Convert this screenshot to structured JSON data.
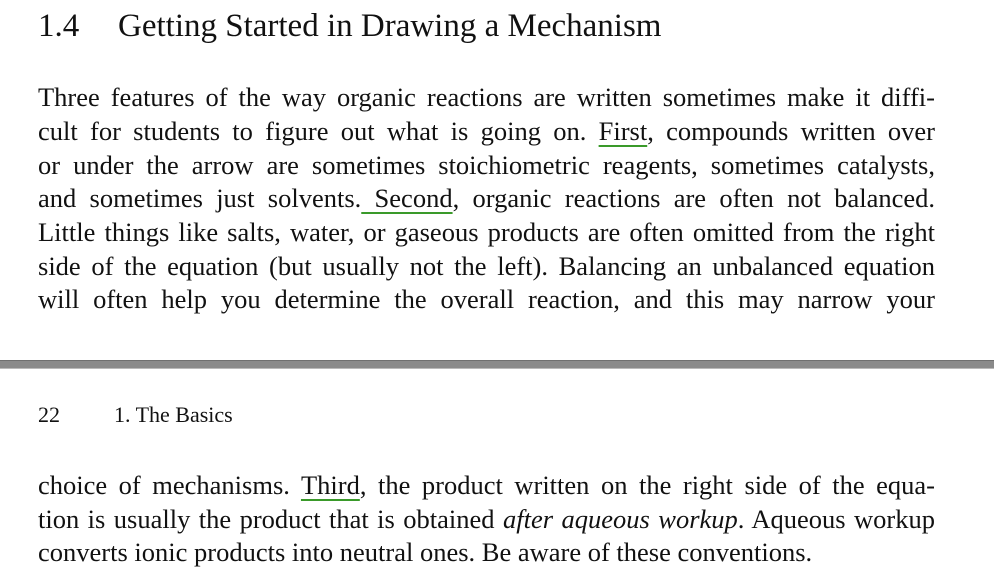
{
  "top_page": {
    "section_number": "1.4",
    "section_title": "Getting Started in Drawing a Mechanism",
    "lines": [
      [
        "Three features of the way organic reactions are written sometimes make it diffi-"
      ],
      [
        "cult for students to figure out what is going on. ",
        "First",
        ", compounds written over"
      ],
      [
        "or under the arrow are sometimes stoichiometric reagents, sometimes catalysts,"
      ],
      [
        "and sometimes just solvents.",
        " Second",
        ", organic reactions are often not balanced."
      ],
      [
        "Little things like salts, water, or gaseous products are often omitted from the right"
      ],
      [
        "side of the equation (but usually not the left). Balancing an unbalanced equation"
      ],
      [
        "will often help you determine the overall reaction, and this may narrow your"
      ]
    ]
  },
  "bottom_page": {
    "page_number": "22",
    "chapter_header": "1. The Basics",
    "lines": [
      [
        "choice of mechanisms. ",
        "Third",
        ", the product written on the right side of the equa-"
      ],
      [
        "tion is usually the product that is obtained ",
        "after aqueous workup",
        ". Aqueous workup"
      ],
      [
        "converts ionic products into neutral ones. Be aware of these conventions."
      ]
    ]
  },
  "highlight_color": "#3a9a2a"
}
